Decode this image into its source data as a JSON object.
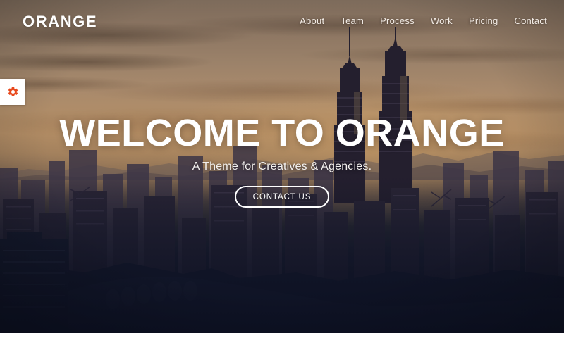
{
  "site": {
    "brand": "ORANGE"
  },
  "nav": {
    "items": [
      {
        "label": "About"
      },
      {
        "label": "Team"
      },
      {
        "label": "Process"
      },
      {
        "label": "Work"
      },
      {
        "label": "Pricing"
      },
      {
        "label": "Contact"
      }
    ]
  },
  "settings_tab": {
    "icon": "gear-icon",
    "color": "#e8491d"
  },
  "hero": {
    "title": "WELCOME TO ORANGE",
    "subtitle": "A Theme for Creatives & Agencies.",
    "cta_label": "CONTACT US",
    "background_image": "kuala-lumpur-skyline-petronas-towers-sunset"
  },
  "colors": {
    "accent": "#e8491d",
    "text_light": "#ffffff",
    "sky_warm": "#b08d68",
    "city_dark": "#151a2c",
    "footer": "#ffffff"
  }
}
